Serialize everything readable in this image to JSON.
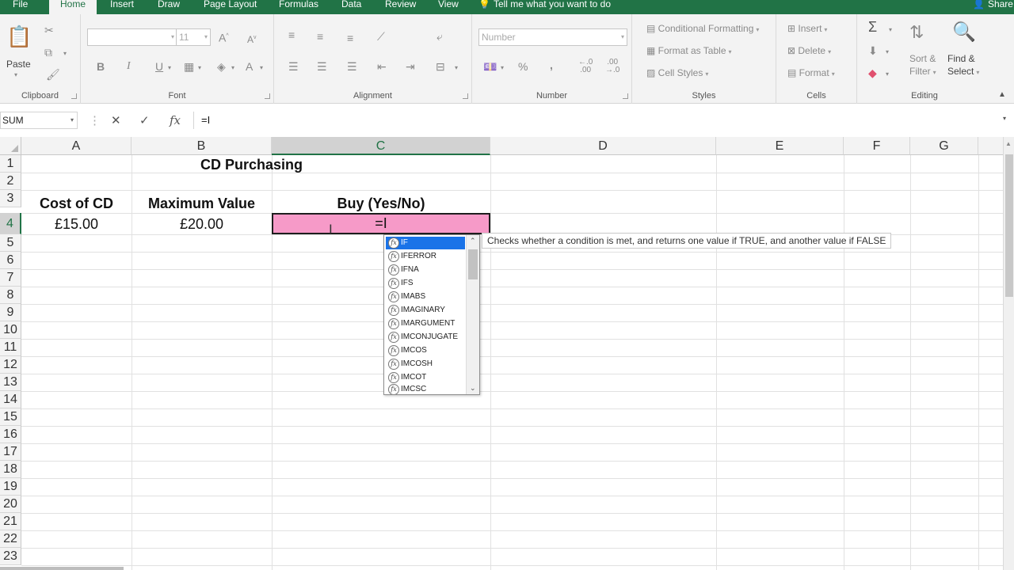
{
  "tabs": [
    {
      "id": "file",
      "label": "File"
    },
    {
      "id": "home",
      "label": "Home"
    },
    {
      "id": "insert",
      "label": "Insert"
    },
    {
      "id": "draw",
      "label": "Draw"
    },
    {
      "id": "pagelayout",
      "label": "Page Layout"
    },
    {
      "id": "formulas",
      "label": "Formulas"
    },
    {
      "id": "data",
      "label": "Data"
    },
    {
      "id": "review",
      "label": "Review"
    },
    {
      "id": "view",
      "label": "View"
    }
  ],
  "tell_me": "Tell me what you want to do",
  "share": "Share",
  "ribbon": {
    "clipboard": {
      "label": "Clipboard",
      "paste": "Paste"
    },
    "font": {
      "label": "Font",
      "font_name": "",
      "font_size": "11",
      "bold": "B",
      "italic": "I",
      "underline": "U"
    },
    "alignment": {
      "label": "Alignment"
    },
    "number": {
      "label": "Number",
      "format": "Number",
      "percent": "%",
      "comma": ","
    },
    "styles": {
      "label": "Styles",
      "conditional": "Conditional Formatting",
      "format_table": "Format as Table",
      "cell_styles": "Cell Styles"
    },
    "cells": {
      "label": "Cells",
      "insert": "Insert",
      "delete": "Delete",
      "format": "Format"
    },
    "editing": {
      "label": "Editing",
      "sort_filter_1": "Sort &",
      "sort_filter_2": "Filter",
      "find_select_1": "Find &",
      "find_select_2": "Select"
    }
  },
  "formula_bar": {
    "name_box": "SUM",
    "formula": "=I"
  },
  "columns": [
    "A",
    "B",
    "C",
    "D",
    "E",
    "F",
    "G"
  ],
  "rows": [
    "1",
    "2",
    "3",
    "4",
    "5",
    "6",
    "7",
    "8",
    "9",
    "10",
    "11",
    "12",
    "13",
    "14",
    "15",
    "16",
    "17",
    "18",
    "19",
    "20",
    "21",
    "22",
    "23"
  ],
  "cells": {
    "title": "CD Purchasing",
    "h_cost": "Cost of CD",
    "h_max": "Maximum Value",
    "h_buy": "Buy (Yes/No)",
    "a4": "£15.00",
    "b4": "£20.00",
    "c4": "=I"
  },
  "autocomplete": {
    "badge": "fx",
    "items": [
      "IF",
      "IFERROR",
      "IFNA",
      "IFS",
      "IMABS",
      "IMAGINARY",
      "IMARGUMENT",
      "IMCONJUGATE",
      "IMCOS",
      "IMCOSH",
      "IMCOT",
      "IMCSC"
    ],
    "tooltip": "Checks whether a condition is met, and returns one value if TRUE, and another value if FALSE"
  },
  "colors": {
    "excel_green": "#217346",
    "active_cell_fill": "#f69ac8",
    "selection_blue": "#1a73e8"
  }
}
